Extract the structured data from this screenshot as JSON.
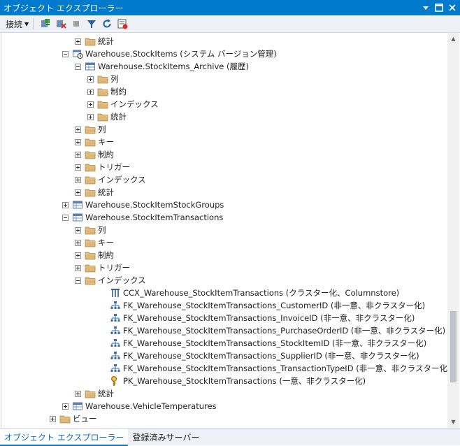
{
  "window": {
    "title": "オブジェクト エクスプローラー"
  },
  "toolbar": {
    "connect_label": "接続",
    "icons": [
      "connect-icon",
      "disconnect-icon",
      "stop-icon",
      "filter-icon",
      "refresh-icon",
      "activity-icon"
    ]
  },
  "tree": {
    "rows": [
      {
        "label": "統計",
        "icon": "folder",
        "expander": "plus"
      },
      {
        "label": "Warehouse.StockItems (システム バージョン管理)",
        "icon": "temporal-table",
        "expander": "minus"
      },
      {
        "label": "Warehouse.StockItems_Archive (履歴)",
        "icon": "table",
        "expander": "minus"
      },
      {
        "label": "列",
        "icon": "folder",
        "expander": "plus"
      },
      {
        "label": "制約",
        "icon": "folder",
        "expander": "plus"
      },
      {
        "label": "インデックス",
        "icon": "folder",
        "expander": "plus"
      },
      {
        "label": "統計",
        "icon": "folder",
        "expander": "plus"
      },
      {
        "label": "列",
        "icon": "folder",
        "expander": "plus"
      },
      {
        "label": "キー",
        "icon": "folder",
        "expander": "plus"
      },
      {
        "label": "制約",
        "icon": "folder",
        "expander": "plus"
      },
      {
        "label": "トリガー",
        "icon": "folder",
        "expander": "plus"
      },
      {
        "label": "インデックス",
        "icon": "folder",
        "expander": "plus"
      },
      {
        "label": "統計",
        "icon": "folder",
        "expander": "plus"
      },
      {
        "label": "Warehouse.StockItemStockGroups",
        "icon": "table",
        "expander": "plus"
      },
      {
        "label": "Warehouse.StockItemTransactions",
        "icon": "table",
        "expander": "minus"
      },
      {
        "label": "列",
        "icon": "folder",
        "expander": "plus"
      },
      {
        "label": "キー",
        "icon": "folder",
        "expander": "plus"
      },
      {
        "label": "制約",
        "icon": "folder",
        "expander": "plus"
      },
      {
        "label": "トリガー",
        "icon": "folder",
        "expander": "plus"
      },
      {
        "label": "インデックス",
        "icon": "folder",
        "expander": "minus"
      },
      {
        "label": "CCX_Warehouse_StockItemTransactions (クラスター化、Columnstore)",
        "icon": "columnstore-index",
        "expander": "none"
      },
      {
        "label": "FK_Warehouse_StockItemTransactions_CustomerID (非一意、非クラスター化)",
        "icon": "index",
        "expander": "none"
      },
      {
        "label": "FK_Warehouse_StockItemTransactions_InvoiceID (非一意、非クラスター化)",
        "icon": "index",
        "expander": "none"
      },
      {
        "label": "FK_Warehouse_StockItemTransactions_PurchaseOrderID (非一意、非クラスター化)",
        "icon": "index",
        "expander": "none"
      },
      {
        "label": "FK_Warehouse_StockItemTransactions_StockItemID (非一意、非クラスター化)",
        "icon": "index",
        "expander": "none"
      },
      {
        "label": "FK_Warehouse_StockItemTransactions_SupplierID (非一意、非クラスター化)",
        "icon": "index",
        "expander": "none"
      },
      {
        "label": "FK_Warehouse_StockItemTransactions_TransactionTypeID (非一意、非クラスター化)",
        "icon": "index",
        "expander": "none"
      },
      {
        "label": "PK_Warehouse_StockItemTransactions (一意、非クラスター化)",
        "icon": "key",
        "expander": "none"
      },
      {
        "label": "統計",
        "icon": "folder",
        "expander": "plus"
      },
      {
        "label": "Warehouse.VehicleTemperatures",
        "icon": "table",
        "expander": "plus"
      },
      {
        "label": "ビュー",
        "icon": "folder",
        "expander": "plus"
      }
    ]
  },
  "bottom_tabs": [
    {
      "label": "オブジェクト エクスプローラー",
      "active": true
    },
    {
      "label": "登録済みサーバー",
      "active": false
    }
  ]
}
